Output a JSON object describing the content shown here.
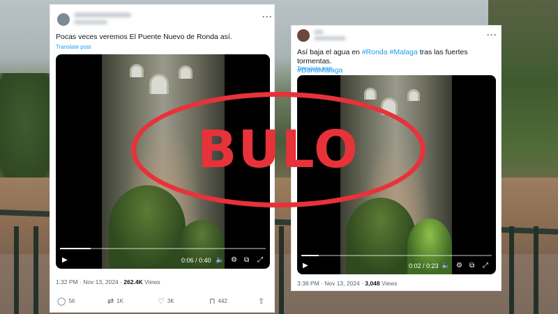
{
  "tweet1": {
    "text": "Pocas veces veremos El Puente Nuevo de Ronda así.",
    "translate": "Translate post",
    "video": {
      "time": "0:06 / 0:40",
      "progress": 0.15
    },
    "time": "1:32 PM",
    "date": "Nov 13, 2024",
    "views_count": "262.4K",
    "views_label": "Views",
    "replies": "56",
    "reposts": "1K",
    "likes": "3K",
    "bookmarks": "442"
  },
  "tweet2": {
    "text_prefix": "Así baja el agua en",
    "hashtag1": "#Ronda",
    "hashtag2": "#Malaga",
    "text_suffix": "tras las fuertes tormentas.",
    "hashtag3": "#DanaMálaga",
    "translate": "Translate post",
    "video": {
      "time": "0:02 / 0:23",
      "progress": 0.09
    },
    "time": "3:38 PM",
    "date": "Nov 13, 2024",
    "views_count": "3,048",
    "views_label": "Views"
  },
  "stamp": {
    "text": "BULO",
    "color": "#e8323a"
  }
}
